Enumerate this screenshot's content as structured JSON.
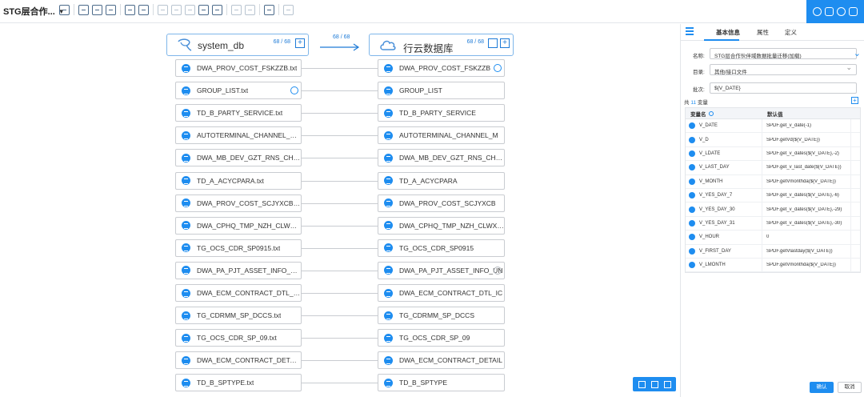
{
  "app": {
    "title": "STG层合作..."
  },
  "source": {
    "name": "system_db",
    "count": "68 / 68"
  },
  "target": {
    "name": "行云数据库",
    "count": "68 / 68"
  },
  "connection": {
    "count": "68 / 68"
  },
  "source_items": [
    "DWA_PROV_COST_FSKZZB.txt",
    "GROUP_LIST.txt",
    "TD_B_PARTY_SERVICE.txt",
    "AUTOTERMINAL_CHANNEL_M.t...",
    "DWA_MB_DEV_GZT_RNS_CHNL...",
    "TD_A_ACYCPARA.txt",
    "DWA_PROV_COST_SCJYXCB.txt",
    "DWA_CPHQ_TMP_NZH_CLWX_G...",
    "TG_OCS_CDR_SP0915.txt",
    "DWA_PA_PJT_ASSET_INFO_UN.t...",
    "DWA_ECM_CONTRACT_DTL_IC...",
    "TG_CDRMM_SP_DCCS.txt",
    "TG_OCS_CDR_SP_09.txt",
    "DWA_ECM_CONTRACT_DETAIL...",
    "TD_B_SPTYPE.txt"
  ],
  "target_items": [
    "DWA_PROV_COST_FSKZZB",
    "GROUP_LIST",
    "TD_B_PARTY_SERVICE",
    "AUTOTERMINAL_CHANNEL_M",
    "DWA_MB_DEV_GZT_RNS_CHNL",
    "TD_A_ACYCPARA",
    "DWA_PROV_COST_SCJYXCB",
    "DWA_CPHQ_TMP_NZH_CLWX_...",
    "TG_OCS_CDR_SP0915",
    "DWA_PA_PJT_ASSET_INFO_UN",
    "DWA_ECM_CONTRACT_DTL_IC",
    "TG_CDRMM_SP_DCCS",
    "TG_OCS_CDR_SP_09",
    "DWA_ECM_CONTRACT_DETAIL",
    "TD_B_SPTYPE"
  ],
  "panel": {
    "tabs": [
      "基本信息",
      "属性",
      "定义"
    ],
    "name_label": "名称:",
    "name_value": "STG层合作伙伴域数据批量迁移(加载)",
    "dir_label": "目录:",
    "dir_value": "其他/接口文件",
    "batch_label": "批次:",
    "batch_value": "${V_DATE}",
    "var_count_prefix": "共",
    "var_count": "11",
    "var_count_suffix": "变量",
    "col_name": "变量名",
    "col_default": "默认值",
    "variables": [
      {
        "name": "V_DATE",
        "value": "SPDF.get_v_date(-1)"
      },
      {
        "name": "V_D",
        "value": "SPDF.getVd(${V_DATE})"
      },
      {
        "name": "V_LDATE",
        "value": "SPDF.get_v_dates(${V_DATE},-2)"
      },
      {
        "name": "V_LAST_DAY",
        "value": "SPDF.get_v_last_date(${V_DATE})"
      },
      {
        "name": "V_MONTH",
        "value": "SPDF.getVmonthda(${V_DATE})"
      },
      {
        "name": "V_YES_DAY_7",
        "value": "SPDF.get_v_dates(${V_DATE},-6)"
      },
      {
        "name": "V_YES_DAY_30",
        "value": "SPDF.get_v_dates(${V_DATE},-29)"
      },
      {
        "name": "V_YES_DAY_31",
        "value": "SPDF.get_v_dates(${V_DATE},-30)"
      },
      {
        "name": "V_HOUR",
        "value": "0"
      },
      {
        "name": "V_FIRST_DAY",
        "value": "SPDF.getVlastday(${V_DATE})"
      },
      {
        "name": "V_LMONTH",
        "value": "SPDF.getVmonthda(${V_DATE})"
      }
    ],
    "ok_label": "确认",
    "cancel_label": "取消"
  },
  "colors": {
    "accent": "#1e8df0",
    "border": "#c9ccd1"
  }
}
